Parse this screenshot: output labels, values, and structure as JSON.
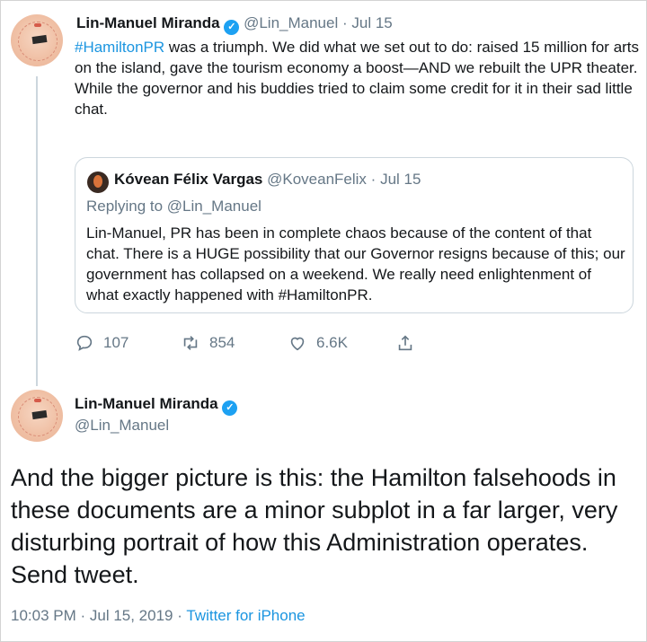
{
  "tweet1": {
    "name": "Lin-Manuel Miranda",
    "handle": "@Lin_Manuel",
    "separator": "·",
    "date": "Jul 15",
    "hashtag": "#HamiltonPR",
    "text_after_hashtag": " was a triumph. We did what we set out to do: raised 15 million for arts on the island, gave the tourism economy a boost—AND we rebuilt the UPR theater.",
    "text_line2": "While the governor and his buddies tried to claim some credit for it in their sad little chat.",
    "verified_icon": "verified-badge-icon"
  },
  "quote": {
    "name": "Kóvean Félix Vargas",
    "handle": "@KoveanFelix",
    "separator": "·",
    "date": "Jul 15",
    "replying_prefix": "Replying to ",
    "replying_handle": "@Lin_Manuel",
    "text": "Lin-Manuel, PR has been in complete chaos because of the content of that chat. There is a HUGE possibility that our Governor resigns because of this; our government has collapsed on a weekend. We really need enlightenment of what exactly happened with #HamiltonPR."
  },
  "actions": {
    "replies": "107",
    "retweets": "854",
    "likes": "6.6K",
    "icons": [
      "reply-icon",
      "retweet-icon",
      "like-icon",
      "share-icon"
    ]
  },
  "tweet2": {
    "name": "Lin-Manuel Miranda",
    "handle": "@Lin_Manuel",
    "text": "And the bigger picture is this: the Hamilton falsehoods in these documents are a minor subplot in a far larger, very disturbing portrait of how this Administration operates. Send tweet.",
    "timestamp": "10:03 PM · Jul 15, 2019",
    "separator": "·",
    "source": "Twitter for iPhone"
  },
  "colors": {
    "link": "#1b95e0",
    "muted": "#657786",
    "text": "#14171a",
    "verified": "#1da1f2",
    "border": "#ccd6dd"
  }
}
